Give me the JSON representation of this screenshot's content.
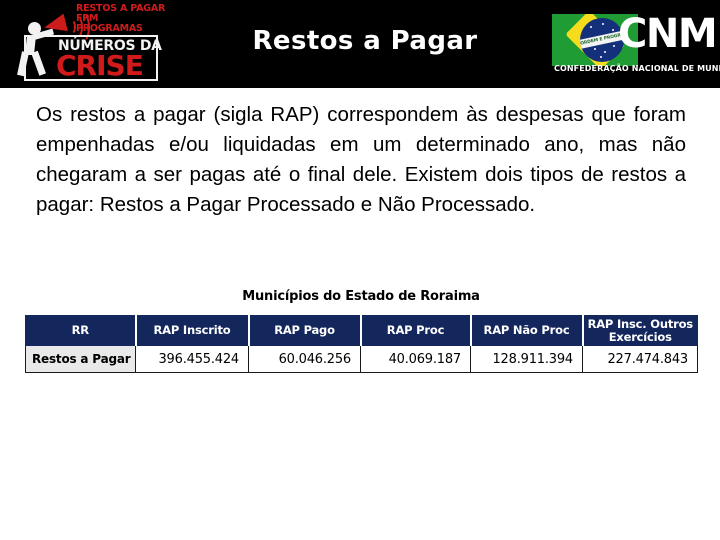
{
  "header": {
    "title": "Restos a Pagar",
    "left_logo": {
      "tagline_lines": [
        "RESTOS A PAGAR",
        "FPM",
        "PROGRAMAS"
      ],
      "word_top": "NÚMEROS DA",
      "word_main": "CRISE"
    },
    "right_logo": {
      "acronym": "CNM",
      "subtitle": "CONFEDERAÇÃO NACIONAL DE MUNICÍPIOS",
      "flag_band_text": "ORDEM E PROGRESSO"
    }
  },
  "body": {
    "paragraph": "Os restos a pagar (sigla RAP) correspondem às despesas que foram empenhadas e/ou liquidadas em um determinado ano, mas não chegaram a ser pagas até o final dele. Existem dois tipos de restos a pagar: Restos a Pagar Processado e Não Processado."
  },
  "table": {
    "caption": "Municípios do Estado de Roraima",
    "columns": [
      "RR",
      "RAP Inscrito",
      "RAP Pago",
      "RAP Proc",
      "RAP Não Proc",
      "RAP Insc. Outros Exercícios"
    ],
    "rows": [
      {
        "label": "Restos a Pagar",
        "rap_inscrito": "396.455.424",
        "rap_pago": "60.046.256",
        "rap_proc": "40.069.187",
        "rap_nao_proc": "128.911.394",
        "rap_insc_outros": "227.474.843"
      }
    ]
  },
  "colors": {
    "header_band": "#000000",
    "table_header": "#13275c",
    "accent_red": "#d11b1b",
    "row_label_bg": "#e9e9e9"
  }
}
